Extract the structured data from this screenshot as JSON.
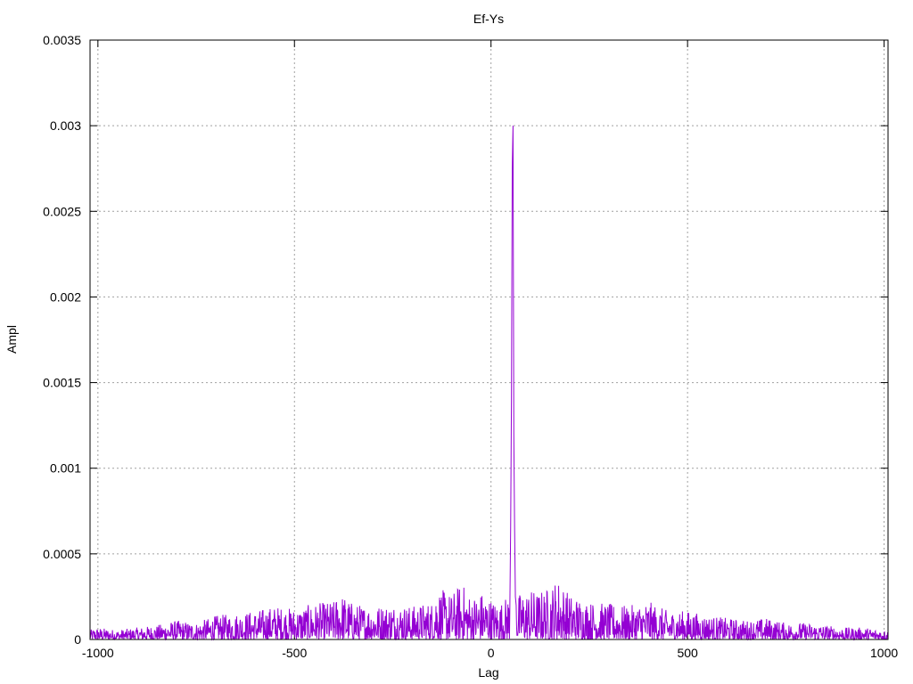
{
  "chart_data": {
    "type": "line",
    "title": "Ef-Ys",
    "xlabel": "Lag",
    "ylabel": "Ampl",
    "xlim": [
      -1020,
      1010
    ],
    "ylim": [
      0,
      0.0035
    ],
    "xticks": [
      -1000,
      -500,
      0,
      500,
      1000
    ],
    "yticks": [
      0,
      0.0005,
      0.001,
      0.0015,
      0.002,
      0.0025,
      0.003,
      0.0035
    ],
    "xtick_labels": [
      "-1000",
      "-500",
      "0",
      "500",
      "1000"
    ],
    "ytick_labels": [
      "0",
      "0.0005",
      "0.001",
      "0.0015",
      "0.002",
      "0.0025",
      "0.003",
      "0.0035"
    ],
    "grid": true,
    "series": [
      {
        "color": "#9400d3",
        "x": [
          -1020,
          -1000,
          -950,
          -900,
          -850,
          -800,
          -750,
          -700,
          -650,
          -600,
          -550,
          -500,
          -450,
          -400,
          -385,
          -350,
          -300,
          -250,
          -200,
          -150,
          -140,
          -100,
          -75,
          -50,
          -25,
          0,
          20,
          40,
          48,
          50,
          52,
          54,
          56,
          58,
          60,
          62,
          64,
          70,
          80,
          100,
          120,
          150,
          170,
          200,
          250,
          300,
          350,
          400,
          450,
          500,
          550,
          600,
          650,
          700,
          750,
          800,
          850,
          900,
          950,
          1000,
          1010
        ],
        "y": [
          4e-05,
          5e-05,
          4e-05,
          5e-05,
          6e-05,
          8e-05,
          7e-05,
          0.0001,
          0.00011,
          0.00012,
          0.00014,
          0.00013,
          0.00015,
          0.00016,
          0.0002,
          0.00015,
          0.00014,
          0.00015,
          0.00014,
          0.00016,
          0.00022,
          0.00019,
          0.00024,
          0.00018,
          0.0002,
          0.00017,
          0.00015,
          0.00018,
          0.0002,
          0.00066,
          0.0014,
          0.00275,
          0.003,
          0.0012,
          0.00065,
          0.00025,
          0.0002,
          0.00019,
          0.0002,
          0.00021,
          0.0002,
          0.00022,
          0.00026,
          0.00019,
          0.00016,
          0.00015,
          0.00014,
          0.00016,
          0.00012,
          0.00012,
          0.0001,
          9e-05,
          8e-05,
          9e-05,
          7e-05,
          7e-05,
          6e-05,
          5e-05,
          5e-05,
          4e-05,
          4e-05
        ]
      }
    ]
  }
}
